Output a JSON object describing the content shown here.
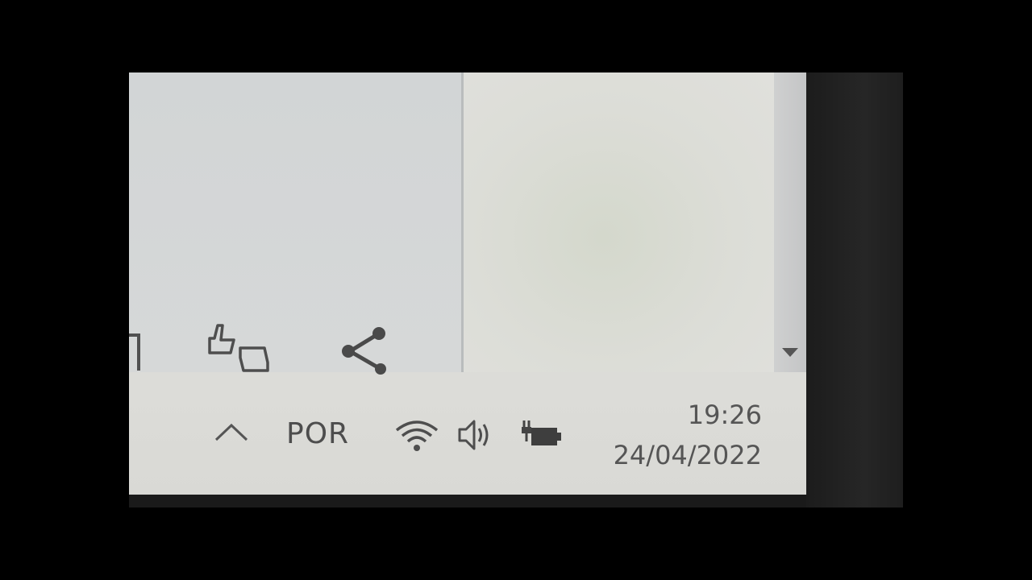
{
  "toolbar": {
    "icons": [
      "partial-icon",
      "like-dislike-icon",
      "share-icon"
    ]
  },
  "content": {
    "scroll_down_icon": "triangle-down-icon"
  },
  "taskbar": {
    "show_hidden_icon": "chevron-up-icon",
    "language": "POR",
    "wifi_icon": "wifi-icon",
    "volume_icon": "speaker-icon",
    "battery_icon": "battery-charging-icon",
    "clock": {
      "time": "19:26",
      "date": "24/04/2022"
    }
  }
}
